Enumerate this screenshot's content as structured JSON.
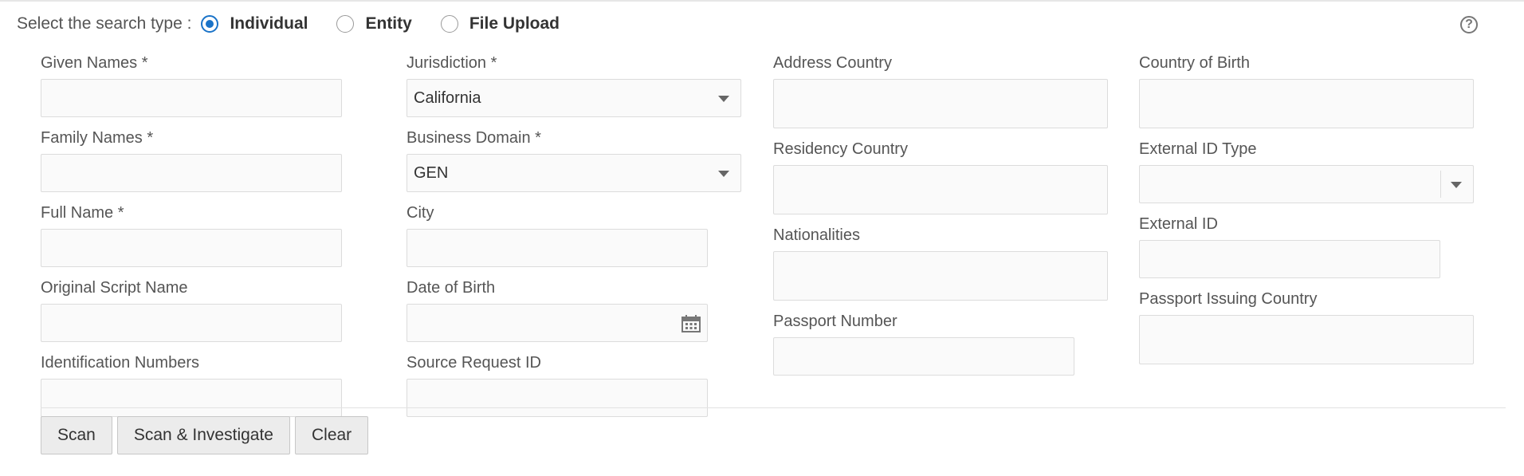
{
  "search_type": {
    "label": "Select the search type :",
    "options": [
      {
        "label": "Individual",
        "selected": true
      },
      {
        "label": "Entity",
        "selected": false
      },
      {
        "label": "File Upload",
        "selected": false
      }
    ]
  },
  "help_icon": "?",
  "form": {
    "given_names": {
      "label": "Given Names *",
      "value": ""
    },
    "family_names": {
      "label": "Family Names *",
      "value": ""
    },
    "full_name": {
      "label": "Full Name *",
      "value": ""
    },
    "original_script_name": {
      "label": "Original Script Name",
      "value": ""
    },
    "identification_numbers": {
      "label": "Identification Numbers",
      "value": ""
    },
    "jurisdiction": {
      "label": "Jurisdiction *",
      "value": "California"
    },
    "business_domain": {
      "label": "Business Domain *",
      "value": "GEN"
    },
    "city": {
      "label": "City",
      "value": ""
    },
    "date_of_birth": {
      "label": "Date of Birth",
      "value": ""
    },
    "source_request_id": {
      "label": "Source Request ID",
      "value": ""
    },
    "address_country": {
      "label": "Address Country",
      "value": ""
    },
    "residency_country": {
      "label": "Residency Country",
      "value": ""
    },
    "nationalities": {
      "label": "Nationalities",
      "value": ""
    },
    "passport_number": {
      "label": "Passport Number",
      "value": ""
    },
    "country_of_birth": {
      "label": "Country of Birth",
      "value": ""
    },
    "external_id_type": {
      "label": "External ID Type",
      "value": ""
    },
    "external_id": {
      "label": "External ID",
      "value": ""
    },
    "passport_issuing_country": {
      "label": "Passport Issuing Country",
      "value": ""
    }
  },
  "buttons": {
    "scan": "Scan",
    "scan_investigate": "Scan & Investigate",
    "clear": "Clear"
  },
  "colors": {
    "accent": "#1a73c8",
    "input_bg": "#fafafa",
    "button_bg": "#ececec"
  }
}
